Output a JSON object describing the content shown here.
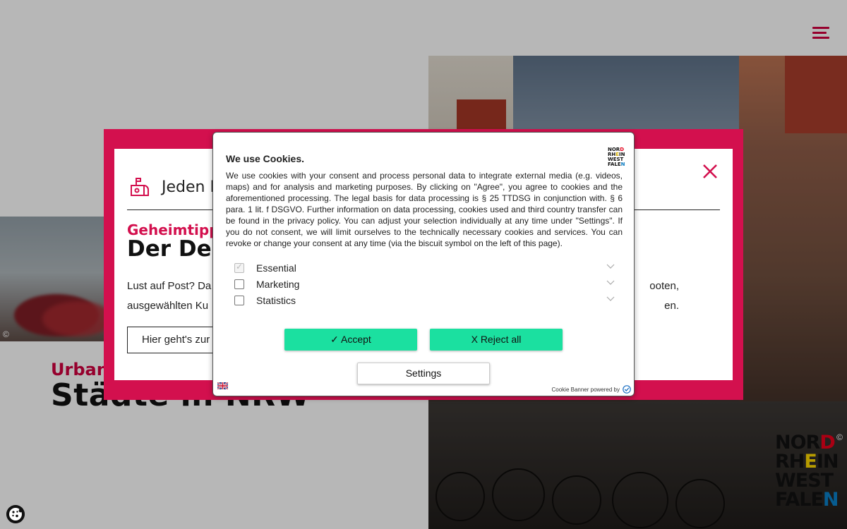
{
  "colors": {
    "brand": "#d3104e",
    "accept_green": "#1be0a0"
  },
  "page": {
    "menu_icon": "hamburger-icon",
    "hero_left_credit": "©",
    "photo_credit": "©",
    "urban_kicker": "Urban",
    "urban_title": "Städte in NRW",
    "logo": {
      "row1": [
        "NOR",
        "D"
      ],
      "row2": [
        "RH",
        "E",
        "IN"
      ],
      "row3": [
        "WEST"
      ],
      "row4": [
        "FALE",
        "N"
      ]
    }
  },
  "newsletter": {
    "heading": "Jeden M",
    "kicker": "Geheimtipp",
    "title": "Der Dei",
    "body_line1_left": "Lust auf Post? Da",
    "body_line1_right": "ooten,",
    "body_line2_left": "ausgewählten Ku",
    "body_line2_right": "en.",
    "cta": "Hier geht's zur",
    "icons": {
      "mailbox": "mailbox-icon",
      "close": "close-icon"
    }
  },
  "cookie": {
    "title": "We use Cookies.",
    "text": "We use cookies with your consent and process personal data to integrate external media (e.g. videos, maps) and for analysis and marketing purposes. By clicking on \"Agree\", you agree to cookies and the aforementioned processing. The legal basis for data processing is § 25 TTDSG in conjunction with. § 6 para. 1 lit. f DSGVO. Further information on data processing, cookies used and third country transfer can be found in the privacy policy. You can adjust your selection individually at any time under \"Settings\". If you do not consent, we will limit ourselves to the technically necessary cookies and services. You can revoke or change your consent at any time (via the biscuit symbol on the left of this page).",
    "logo": {
      "row1": [
        "NOR",
        "D"
      ],
      "row2": [
        "RH",
        "E",
        "IN"
      ],
      "row3": [
        "WEST"
      ],
      "row4": [
        "FALE",
        "N"
      ]
    },
    "categories": [
      {
        "label": "Essential",
        "checked": true,
        "disabled": true
      },
      {
        "label": "Marketing",
        "checked": false,
        "disabled": false
      },
      {
        "label": "Statistics",
        "checked": false,
        "disabled": false
      }
    ],
    "accept_label": "✓ Accept",
    "reject_label": "X Reject all",
    "settings_label": "Settings",
    "powered_by": "Cookie Banner powered by",
    "language_icon": "uk-flag-icon",
    "biscuit_icon": "cookie-icon"
  }
}
